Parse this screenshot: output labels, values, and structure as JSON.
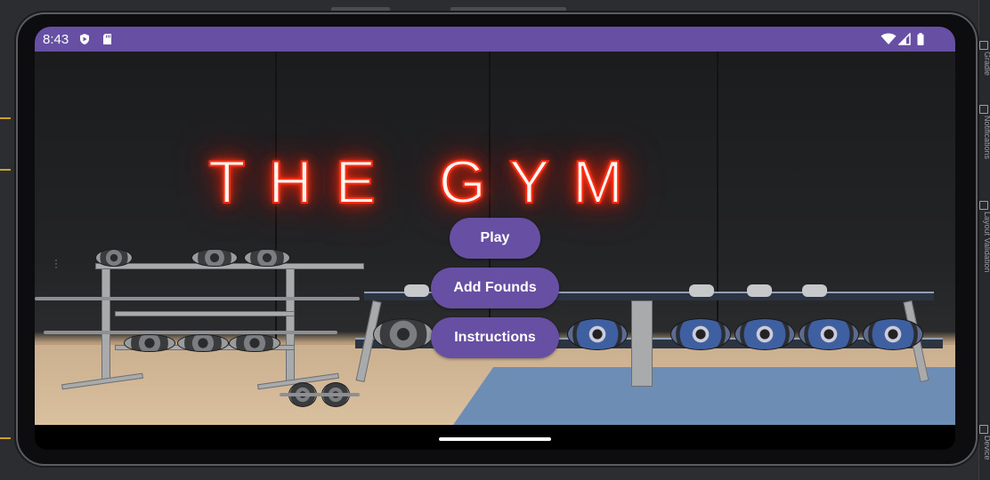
{
  "status_bar": {
    "time": "8:43",
    "left_icons": [
      "shield-icon",
      "sd-card-icon"
    ],
    "right_icons": [
      "wifi-icon",
      "signal-icon",
      "battery-icon"
    ],
    "color": "#6750a4"
  },
  "scene": {
    "sign_text": "THE GYM",
    "sign_color": "#ff2a12"
  },
  "menu": {
    "play_label": "Play",
    "add_funds_label": "Add Founds",
    "instructions_label": "Instructions",
    "button_color": "#6750a4"
  },
  "ide": {
    "side_labels": [
      "Gradle",
      "Notifications",
      "Layout Validation",
      "Device"
    ]
  }
}
